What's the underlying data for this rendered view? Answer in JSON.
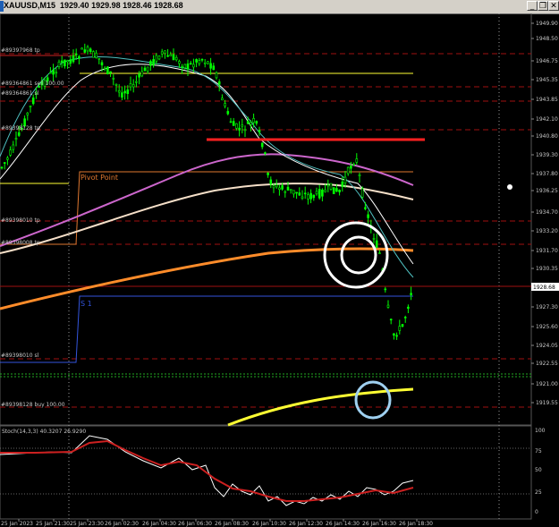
{
  "window": {
    "title_prefix": "XAUUSD,M15",
    "ohlc": "1929.40 1929.98 1928.46 1928.68",
    "minimize_glyph": "_",
    "restore_glyph": "❐",
    "close_glyph": "✕"
  },
  "price_axis": {
    "labels": [
      "1949.90",
      "1948.50",
      "1946.75",
      "1945.35",
      "1943.85",
      "1942.10",
      "1940.80",
      "1939.30",
      "1937.80",
      "1936.25",
      "1934.70",
      "1933.20",
      "1931.70",
      "1930.35",
      "1928.68",
      "1927.30",
      "1925.60",
      "1924.05",
      "1922.55",
      "1921.00",
      "1919.55"
    ],
    "current": "1928.68"
  },
  "osc_axis": {
    "labels": [
      "100",
      "75",
      "50",
      "25",
      "0"
    ]
  },
  "time_axis": {
    "labels": [
      "25 Jan 2023",
      "25 Jan 21:30",
      "25 Jan 23:30",
      "26 Jan 02:30",
      "26 Jan 04:30",
      "26 Jan 06:30",
      "26 Jan 08:30",
      "26 Jan 10:30",
      "26 Jan 12:30",
      "26 Jan 14:30",
      "26 Jan 16:30",
      "26 Jan 18:30"
    ]
  },
  "order_labels": [
    "#89397968 tp",
    "#89364861 sell 100.00",
    "#89364861 sl",
    "#89398128 tp",
    "#89398010 tp",
    "#89398008 tp",
    "#89398010 sl",
    "#89398128 buy 100.00"
  ],
  "pivot_label": "Pivot Point",
  "s1_label": "S 1",
  "oscillator_label": "Stoch(14,3,3) 40.3207 26.9290",
  "colors": {
    "background": "#000000",
    "bull": "#00ff00",
    "bear": "#00ff00",
    "red_dashed": "#a01010",
    "resistance": "#ff2020",
    "white": "#ffffff",
    "yellow": "#ffff33",
    "orange": "#ff8c2a",
    "violet": "#cc66cc",
    "circle_blue": "#9fd0f0"
  }
}
